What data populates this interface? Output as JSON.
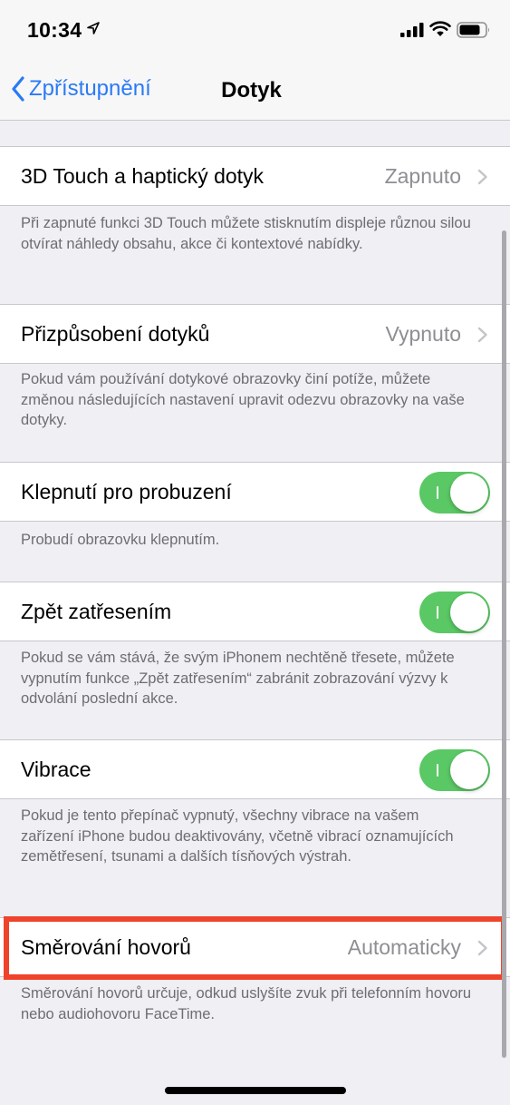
{
  "status_bar": {
    "time": "10:34",
    "icons": [
      "location-arrow-icon",
      "cellular-signal-icon",
      "wifi-icon",
      "battery-icon"
    ]
  },
  "nav": {
    "back_label": "Zpřístupnění",
    "title": "Dotyk",
    "accent_color": "#2a7af5"
  },
  "settings": [
    {
      "label": "3D Touch a haptický dotyk",
      "value": "Zapnuto",
      "control": "disclosure",
      "footer": "Při zapnuté funkci 3D Touch můžete stisknutím displeje různou silou otvírat náhledy obsahu, akce či kontextové nabídky."
    },
    {
      "label": "Přizpůsobení dotyků",
      "value": "Vypnuto",
      "control": "disclosure",
      "footer": "Pokud vám používání dotykové obrazovky činí potíže, můžete změnou následujících nastavení upravit odezvu obrazovky na vaše dotyky."
    },
    {
      "label": "Klepnutí pro probuzení",
      "control": "toggle",
      "on": true,
      "footer": "Probudí obrazovku klepnutím."
    },
    {
      "label": "Zpět zatřesením",
      "control": "toggle",
      "on": true,
      "footer": "Pokud se vám stává, že svým iPhonem nechtěně třesete, můžete vypnutím funkce „Zpět zatřesením“ zabránit zobrazování výzvy k odvolání poslední akce."
    },
    {
      "label": "Vibrace",
      "control": "toggle",
      "on": true,
      "footer": "Pokud je tento přepínač vypnutý, všechny vibrace na vašem zařízení iPhone budou deaktivovány, včetně vibrací oznamujících zemětřesení, tsunami a dalších tísňových výstrah."
    },
    {
      "label": "Směrování hovorů",
      "value": "Automaticky",
      "control": "disclosure",
      "highlighted": true,
      "footer": "Směrování hovorů určuje, odkud uslyšíte zvuk při telefonním hovoru nebo audiohovoru FaceTime."
    }
  ],
  "colors": {
    "toggle_on": "#5ac864",
    "highlight": "#f0432b",
    "background": "#efeff4"
  }
}
